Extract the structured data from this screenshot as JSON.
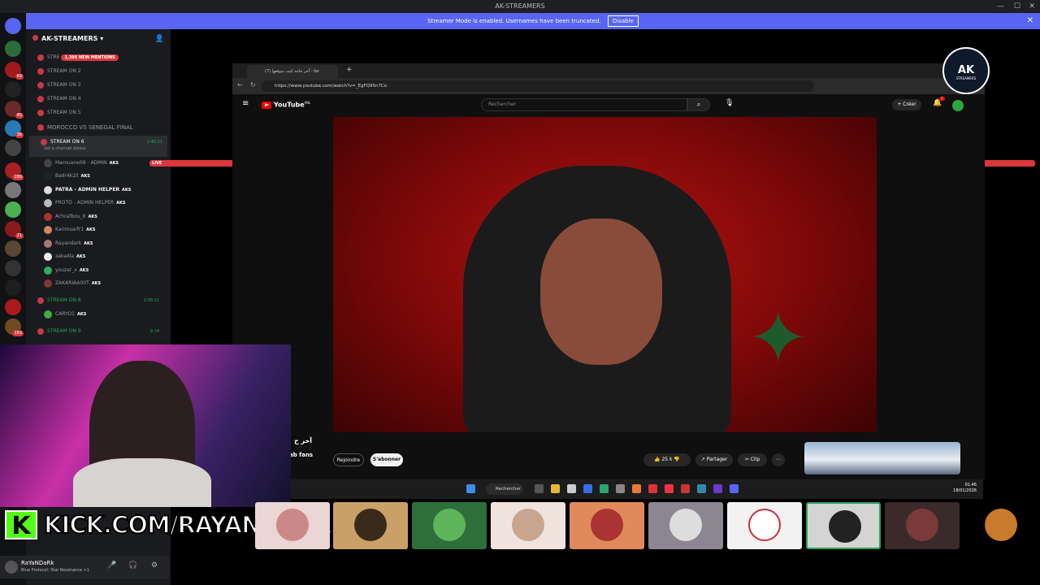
{
  "window": {
    "title": "AK-STREAMERS"
  },
  "banner": {
    "text": "Streamer Mode is enabled. Usernames have been truncated.",
    "button": "Disable"
  },
  "server": {
    "name": "AK-STREAMERS"
  },
  "channels": [
    {
      "name": "STRE",
      "mention": "1,386 NEW MENTIONS"
    },
    {
      "name": "STREAM ON 2"
    },
    {
      "name": "STREAM ON 3"
    },
    {
      "name": "STREAM ON 4"
    },
    {
      "name": "STREAM ON 5"
    },
    {
      "name": "MOROCCO VS SENEGAL FINAL"
    },
    {
      "name": "STREAM ON 6",
      "time": "2:46:21",
      "status": "Set a channel status",
      "live": "LIVE"
    },
    {
      "name": "STREAM ON 8",
      "time": "2:09:21"
    },
    {
      "name": "STREAM ON 9",
      "time": "9:14"
    }
  ],
  "members_stream6": [
    {
      "name": "Marouane09 - ADMIN",
      "tag": "AKS"
    },
    {
      "name": "Badr4k2il",
      "tag": "AKS"
    },
    {
      "name": "PATRA - ADMIN HELPER",
      "tag": "AKS"
    },
    {
      "name": "PROTO - ADMIN HELPER",
      "tag": "AKS"
    },
    {
      "name": "Achrafbou_6",
      "tag": "AKS"
    },
    {
      "name": "Karimsarfr1",
      "tag": "AKS"
    },
    {
      "name": "Rayandark",
      "tag": "AKS"
    },
    {
      "name": "zaka4la",
      "tag": "AKS"
    },
    {
      "name": "youzar_x",
      "tag": "AKS"
    },
    {
      "name": "ZAKARIAA00T",
      "tag": "AKS"
    }
  ],
  "members_stream8": [
    {
      "name": "CARYO1",
      "tag": "AKS"
    }
  ],
  "browser": {
    "tab_title": "(7) آخر حاجة كنت متوقعها - be",
    "url": "https://www.youtube.com/watch?v=_EgFQ95n7Co"
  },
  "youtube": {
    "logo": "YouTube",
    "country": "MA",
    "search_placeholder": "Rechercher",
    "create_label": "Créer",
    "notif_count": "7",
    "video_title_fragment": "آخر ح",
    "channel_fragment": "ab fans",
    "join_label": "Rejoindre",
    "subscribe_label": "S'abonner",
    "likes": "25 k",
    "share_label": "Partager",
    "clip_label": "Clip"
  },
  "kick": {
    "text": "KICK.COM/RAYANDARK"
  },
  "taskbar": {
    "search_label": "Rechercher",
    "time": "01:46",
    "date": "18/01/2026"
  },
  "tiles": [
    {
      "name": "tile-1"
    },
    {
      "name": "tile-marouane"
    },
    {
      "name": "tile-3"
    },
    {
      "name": "tile-4"
    },
    {
      "name": "tile-5"
    },
    {
      "name": "tile-6"
    },
    {
      "name": "tile-7"
    },
    {
      "name": "tile-8"
    },
    {
      "name": "tile-9"
    },
    {
      "name": "tile-yarim"
    }
  ],
  "user": {
    "name": "RaYaNDaRk",
    "status": "Blue Protocol: Star Resonance +1"
  },
  "logo": {
    "text": "AK",
    "sub": "STREAMERS"
  }
}
